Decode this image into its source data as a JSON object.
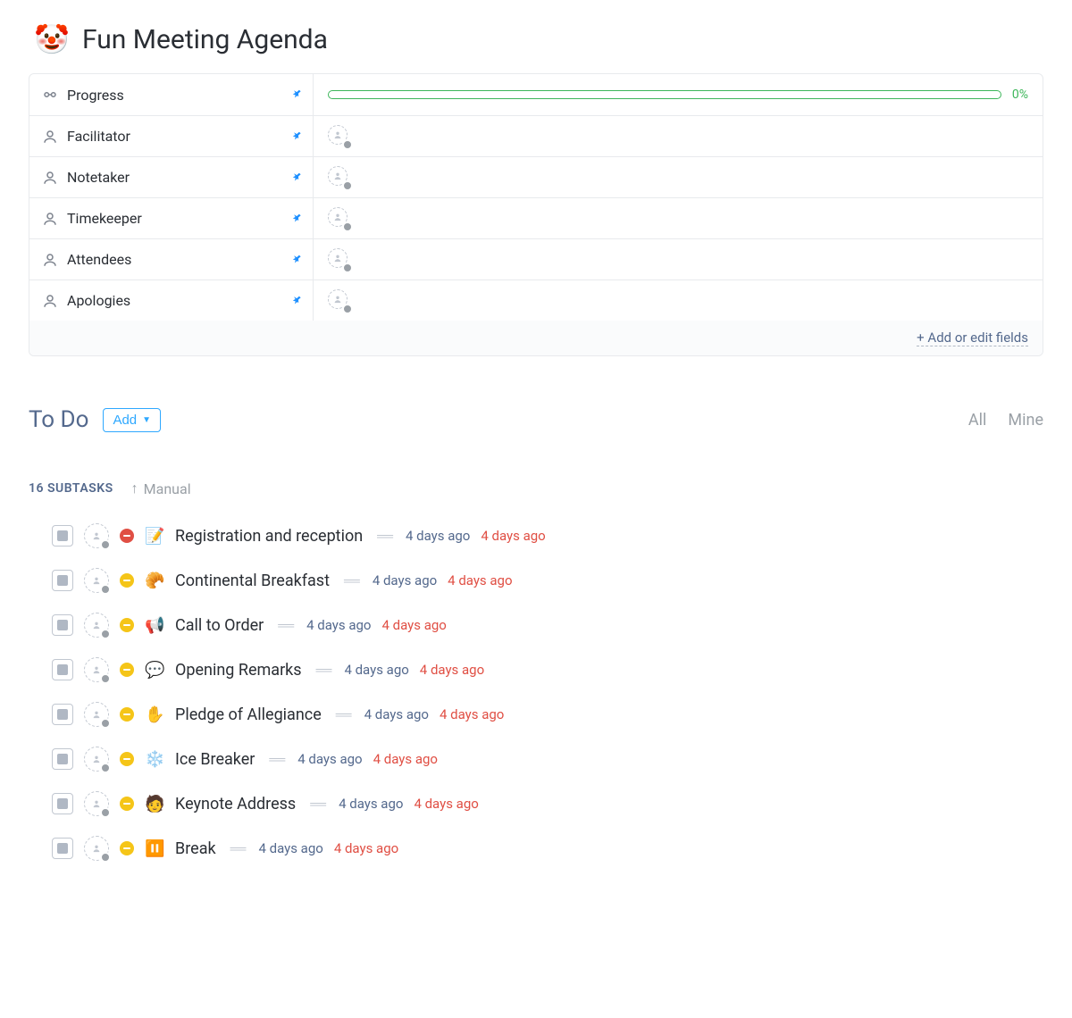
{
  "header": {
    "icon": "🤡",
    "title": "Fun Meeting Agenda"
  },
  "fields": [
    {
      "icon": "progress",
      "label": "Progress",
      "type": "progress",
      "percent": 0,
      "percent_text": "0%"
    },
    {
      "icon": "person",
      "label": "Facilitator",
      "type": "person"
    },
    {
      "icon": "person",
      "label": "Notetaker",
      "type": "person"
    },
    {
      "icon": "person",
      "label": "Timekeeper",
      "type": "person"
    },
    {
      "icon": "person",
      "label": "Attendees",
      "type": "person"
    },
    {
      "icon": "person",
      "label": "Apologies",
      "type": "person"
    }
  ],
  "fields_footer": {
    "add_edit_label": "+ Add or edit fields"
  },
  "todo": {
    "title": "To Do",
    "add_label": "Add",
    "filters": {
      "all": "All",
      "mine": "Mine"
    }
  },
  "subtasks": {
    "count_label": "16 SUBTASKS",
    "sort_label": "Manual"
  },
  "tasks": [
    {
      "priority": "red",
      "emoji": "📝",
      "name": "Registration and reception",
      "created": "4 days ago",
      "due": "4 days ago"
    },
    {
      "priority": "yellow",
      "emoji": "🥐",
      "name": "Continental Breakfast",
      "created": "4 days ago",
      "due": "4 days ago"
    },
    {
      "priority": "yellow",
      "emoji": "📢",
      "name": "Call to Order",
      "created": "4 days ago",
      "due": "4 days ago"
    },
    {
      "priority": "yellow",
      "emoji": "💬",
      "name": "Opening Remarks",
      "created": "4 days ago",
      "due": "4 days ago"
    },
    {
      "priority": "yellow",
      "emoji": "✋",
      "name": "Pledge of Allegiance",
      "created": "4 days ago",
      "due": "4 days ago"
    },
    {
      "priority": "yellow",
      "emoji": "❄️",
      "name": "Ice Breaker",
      "created": "4 days ago",
      "due": "4 days ago"
    },
    {
      "priority": "yellow",
      "emoji": "🧑",
      "name": "Keynote Address",
      "created": "4 days ago",
      "due": "4 days ago"
    },
    {
      "priority": "yellow",
      "emoji": "⏸️",
      "name": "Break",
      "created": "4 days ago",
      "due": "4 days ago"
    }
  ]
}
